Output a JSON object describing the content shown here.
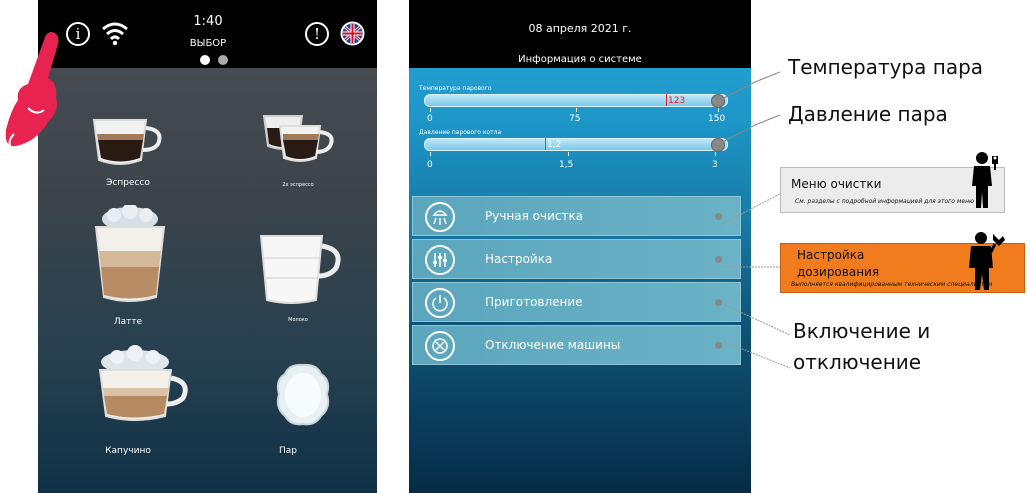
{
  "left_screen": {
    "time": "1:40",
    "mode_label": "ВЫБОР",
    "info_icon": "info-icon",
    "wifi_icon": "wifi-icon",
    "alert_icon": "alert-icon",
    "language_icon": "uk-flag-icon",
    "page_dots": 2,
    "drinks": [
      {
        "label": "Эспрессо",
        "icon": "espresso-cup-icon"
      },
      {
        "label": "2x эспрессо",
        "icon": "double-espresso-icon"
      },
      {
        "label": "Латте",
        "icon": "latte-glass-icon"
      },
      {
        "label": "Молоко",
        "icon": "milk-cup-icon"
      },
      {
        "label": "Капучино",
        "icon": "cappuccino-cup-icon"
      },
      {
        "label": "Пар",
        "icon": "steam-icon"
      }
    ]
  },
  "right_screen": {
    "date": "08 апреля 2021 г.",
    "title": "Информация о системе",
    "gauges": [
      {
        "label": "Температура парового",
        "value": "123",
        "value_num": 123,
        "min": 0,
        "max": 150,
        "ticks": [
          "0",
          "75",
          "150"
        ]
      },
      {
        "label": "Давление парового котла",
        "value": "1,2",
        "value_num": 1.2,
        "min": 0,
        "max": 3,
        "ticks": [
          "0",
          "1,5",
          "3"
        ]
      }
    ],
    "menu_items": [
      {
        "label": "Ручная очистка",
        "icon": "shower-clean-icon"
      },
      {
        "label": "Настройка",
        "icon": "sliders-icon"
      },
      {
        "label": "Приготовление",
        "icon": "power-icon"
      },
      {
        "label": "Отключение машины",
        "icon": "cancel-icon"
      }
    ]
  },
  "annotations": {
    "steam_temp": "Температура пара",
    "steam_pressure": "Давление пара",
    "cleaning_menu": {
      "title": "Меню очистки",
      "note": "См. разделы с подробной информацией для этого меню"
    },
    "dosing_setup": {
      "title_line1": "Настройка",
      "title_line2": "дозирования",
      "note": "Выполняется квалифицированным техническим специалистом"
    },
    "on_off_line1": "Включение и",
    "on_off_line2": "отключение",
    "colors": {
      "dosing_box": "#f07c1e",
      "cleaning_box": "#ececec",
      "hand": "#e8234f"
    }
  }
}
